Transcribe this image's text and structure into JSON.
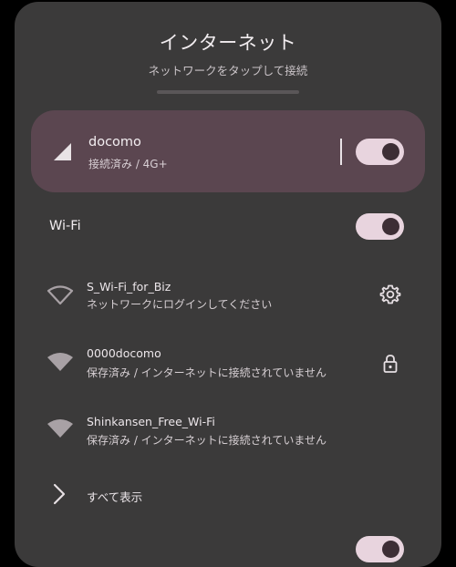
{
  "header": {
    "title": "インターネット",
    "subtitle": "ネットワークをタップして接続"
  },
  "mobile": {
    "name": "docomo",
    "status": "接続済み / 4G+",
    "toggle_on": true,
    "icon": "cell-signal-icon"
  },
  "wifi": {
    "label": "Wi-Fi",
    "toggle_on": true
  },
  "networks": [
    {
      "name": "S_Wi-Fi_for_Biz",
      "status": "ネットワークにログインしてください",
      "icon": "wifi-icon",
      "action": "gear-icon"
    },
    {
      "name": "0000docomo",
      "status": "保存済み / インターネットに接続されていません",
      "icon": "wifi-icon",
      "action": "lock-icon"
    },
    {
      "name": "Shinkansen_Free_Wi-Fi",
      "status": "保存済み / インターネットに接続されていません",
      "icon": "wifi-icon",
      "action": ""
    }
  ],
  "show_all": {
    "label": "すべて表示",
    "icon": "chevron-right-icon"
  },
  "colors": {
    "sheet": "#3b3a3a",
    "card": "#5b4650",
    "toggle_track": "#e8d4de",
    "toggle_knob": "#3d2e35",
    "icon": "#a8a1a5"
  }
}
